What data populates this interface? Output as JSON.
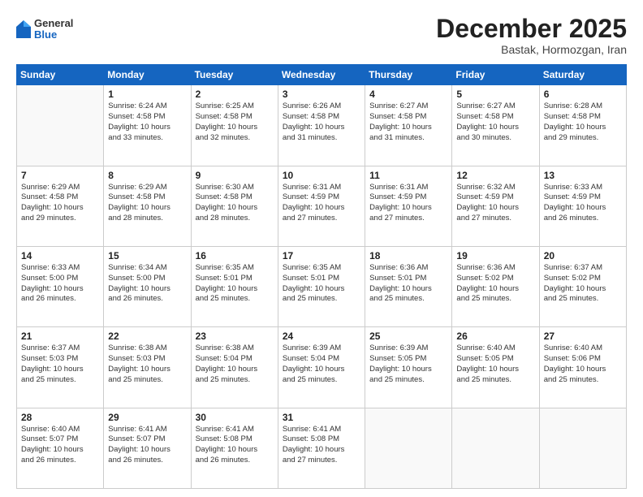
{
  "header": {
    "logo": {
      "general": "General",
      "blue": "Blue"
    },
    "title": "December 2025",
    "subtitle": "Bastak, Hormozgan, Iran"
  },
  "calendar": {
    "weekdays": [
      "Sunday",
      "Monday",
      "Tuesday",
      "Wednesday",
      "Thursday",
      "Friday",
      "Saturday"
    ],
    "weeks": [
      [
        {
          "day": "",
          "info": ""
        },
        {
          "day": "1",
          "info": "Sunrise: 6:24 AM\nSunset: 4:58 PM\nDaylight: 10 hours\nand 33 minutes."
        },
        {
          "day": "2",
          "info": "Sunrise: 6:25 AM\nSunset: 4:58 PM\nDaylight: 10 hours\nand 32 minutes."
        },
        {
          "day": "3",
          "info": "Sunrise: 6:26 AM\nSunset: 4:58 PM\nDaylight: 10 hours\nand 31 minutes."
        },
        {
          "day": "4",
          "info": "Sunrise: 6:27 AM\nSunset: 4:58 PM\nDaylight: 10 hours\nand 31 minutes."
        },
        {
          "day": "5",
          "info": "Sunrise: 6:27 AM\nSunset: 4:58 PM\nDaylight: 10 hours\nand 30 minutes."
        },
        {
          "day": "6",
          "info": "Sunrise: 6:28 AM\nSunset: 4:58 PM\nDaylight: 10 hours\nand 29 minutes."
        }
      ],
      [
        {
          "day": "7",
          "info": "Sunrise: 6:29 AM\nSunset: 4:58 PM\nDaylight: 10 hours\nand 29 minutes."
        },
        {
          "day": "8",
          "info": "Sunrise: 6:29 AM\nSunset: 4:58 PM\nDaylight: 10 hours\nand 28 minutes."
        },
        {
          "day": "9",
          "info": "Sunrise: 6:30 AM\nSunset: 4:58 PM\nDaylight: 10 hours\nand 28 minutes."
        },
        {
          "day": "10",
          "info": "Sunrise: 6:31 AM\nSunset: 4:59 PM\nDaylight: 10 hours\nand 27 minutes."
        },
        {
          "day": "11",
          "info": "Sunrise: 6:31 AM\nSunset: 4:59 PM\nDaylight: 10 hours\nand 27 minutes."
        },
        {
          "day": "12",
          "info": "Sunrise: 6:32 AM\nSunset: 4:59 PM\nDaylight: 10 hours\nand 27 minutes."
        },
        {
          "day": "13",
          "info": "Sunrise: 6:33 AM\nSunset: 4:59 PM\nDaylight: 10 hours\nand 26 minutes."
        }
      ],
      [
        {
          "day": "14",
          "info": "Sunrise: 6:33 AM\nSunset: 5:00 PM\nDaylight: 10 hours\nand 26 minutes."
        },
        {
          "day": "15",
          "info": "Sunrise: 6:34 AM\nSunset: 5:00 PM\nDaylight: 10 hours\nand 26 minutes."
        },
        {
          "day": "16",
          "info": "Sunrise: 6:35 AM\nSunset: 5:01 PM\nDaylight: 10 hours\nand 25 minutes."
        },
        {
          "day": "17",
          "info": "Sunrise: 6:35 AM\nSunset: 5:01 PM\nDaylight: 10 hours\nand 25 minutes."
        },
        {
          "day": "18",
          "info": "Sunrise: 6:36 AM\nSunset: 5:01 PM\nDaylight: 10 hours\nand 25 minutes."
        },
        {
          "day": "19",
          "info": "Sunrise: 6:36 AM\nSunset: 5:02 PM\nDaylight: 10 hours\nand 25 minutes."
        },
        {
          "day": "20",
          "info": "Sunrise: 6:37 AM\nSunset: 5:02 PM\nDaylight: 10 hours\nand 25 minutes."
        }
      ],
      [
        {
          "day": "21",
          "info": "Sunrise: 6:37 AM\nSunset: 5:03 PM\nDaylight: 10 hours\nand 25 minutes."
        },
        {
          "day": "22",
          "info": "Sunrise: 6:38 AM\nSunset: 5:03 PM\nDaylight: 10 hours\nand 25 minutes."
        },
        {
          "day": "23",
          "info": "Sunrise: 6:38 AM\nSunset: 5:04 PM\nDaylight: 10 hours\nand 25 minutes."
        },
        {
          "day": "24",
          "info": "Sunrise: 6:39 AM\nSunset: 5:04 PM\nDaylight: 10 hours\nand 25 minutes."
        },
        {
          "day": "25",
          "info": "Sunrise: 6:39 AM\nSunset: 5:05 PM\nDaylight: 10 hours\nand 25 minutes."
        },
        {
          "day": "26",
          "info": "Sunrise: 6:40 AM\nSunset: 5:05 PM\nDaylight: 10 hours\nand 25 minutes."
        },
        {
          "day": "27",
          "info": "Sunrise: 6:40 AM\nSunset: 5:06 PM\nDaylight: 10 hours\nand 25 minutes."
        }
      ],
      [
        {
          "day": "28",
          "info": "Sunrise: 6:40 AM\nSunset: 5:07 PM\nDaylight: 10 hours\nand 26 minutes."
        },
        {
          "day": "29",
          "info": "Sunrise: 6:41 AM\nSunset: 5:07 PM\nDaylight: 10 hours\nand 26 minutes."
        },
        {
          "day": "30",
          "info": "Sunrise: 6:41 AM\nSunset: 5:08 PM\nDaylight: 10 hours\nand 26 minutes."
        },
        {
          "day": "31",
          "info": "Sunrise: 6:41 AM\nSunset: 5:08 PM\nDaylight: 10 hours\nand 27 minutes."
        },
        {
          "day": "",
          "info": ""
        },
        {
          "day": "",
          "info": ""
        },
        {
          "day": "",
          "info": ""
        }
      ]
    ]
  }
}
